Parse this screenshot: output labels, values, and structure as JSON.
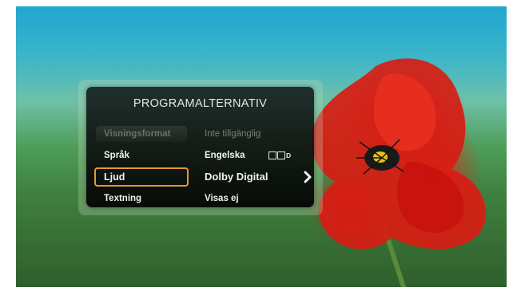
{
  "menu": {
    "title": "PROGRAMALTERNATIV",
    "rows": [
      {
        "label": "Visningsformat",
        "value": "Inte tillgänglig",
        "state": "disabled"
      },
      {
        "label": "Språk",
        "value": "Engelska",
        "badge_text": "D"
      },
      {
        "label": "Ljud",
        "value": "Dolby Digital",
        "state": "selected"
      },
      {
        "label": "Textning",
        "value": "Visas ej"
      }
    ]
  },
  "colors": {
    "highlight": "#e59a2c",
    "panel": "#0a0e0e",
    "text": "#f2f2f2"
  },
  "icons": {
    "badge": "dolby-digital-badge-icon",
    "next": "chevron-right-icon"
  }
}
